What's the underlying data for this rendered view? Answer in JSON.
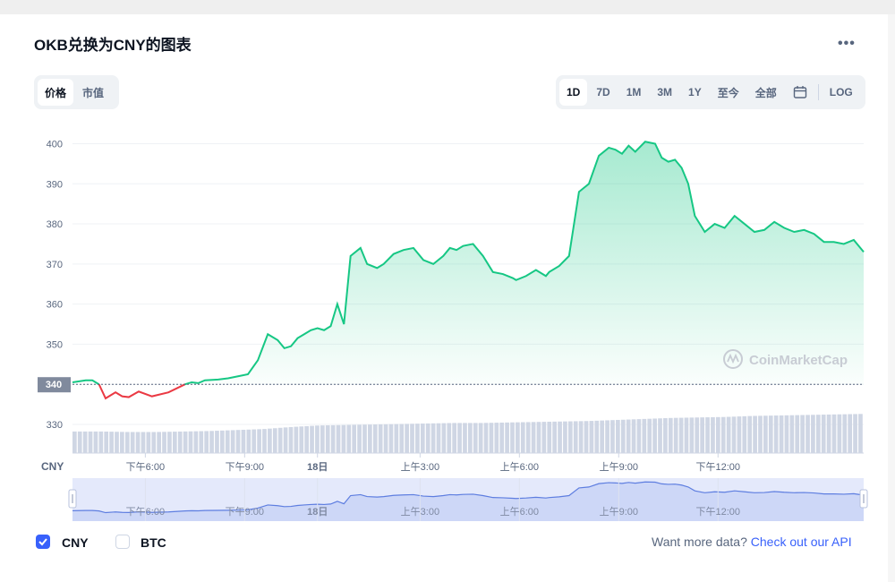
{
  "title": "OKB兑换为CNY的图表",
  "menu_icon": "more-dots-icon",
  "view_toggle": {
    "items": [
      "价格",
      "市值"
    ],
    "active": 0
  },
  "range_toggle": {
    "items": [
      "1D",
      "7D",
      "1M",
      "3M",
      "1Y",
      "至今",
      "全部"
    ],
    "active": 0,
    "calendar_icon": "calendar-icon",
    "log_label": "LOG"
  },
  "colors": {
    "up": "#16c784",
    "down": "#ea3943",
    "accent": "#3861fb",
    "volume": "#cfd6e4"
  },
  "chart_data": {
    "type": "line",
    "currency_label": "CNY",
    "watermark": "CoinMarketCap",
    "reference_price": 340,
    "reference_label": "340",
    "y_ticks": [
      400,
      390,
      380,
      370,
      360,
      350,
      340,
      330
    ],
    "ylim": [
      330,
      401
    ],
    "x_ticks": [
      "下午6:00",
      "下午9:00",
      "18日",
      "上午3:00",
      "上午6:00",
      "上午9:00",
      "下午12:00"
    ],
    "x_tick_positions": [
      3.8,
      6.8,
      9.0,
      12.1,
      15.1,
      18.1,
      21.1
    ],
    "xlim": [
      1.6,
      25.5
    ],
    "grid": true,
    "series": [
      {
        "x": [
          1.6,
          2.0,
          2.2,
          2.4,
          2.6,
          2.9,
          3.1,
          3.3,
          3.6,
          4.0,
          4.5,
          5.0,
          5.2,
          5.4,
          5.6,
          6.0,
          6.3,
          6.6,
          6.9,
          7.2,
          7.5,
          7.8,
          8.0,
          8.2,
          8.4,
          8.6,
          8.8,
          9.0,
          9.2,
          9.4,
          9.6,
          9.8,
          10.0,
          10.3,
          10.5,
          10.8,
          11.0,
          11.3,
          11.6,
          11.9,
          12.2,
          12.5,
          12.8,
          13.0,
          13.2,
          13.4,
          13.7,
          14.0,
          14.3,
          14.6,
          14.9,
          15.0,
          15.3,
          15.6,
          15.9,
          16.0,
          16.3,
          16.6,
          16.9,
          17.2,
          17.5,
          17.8,
          18.0,
          18.2,
          18.4,
          18.6,
          18.9,
          19.2,
          19.4,
          19.6,
          19.8,
          20.0,
          20.2,
          20.4,
          20.7,
          21.0,
          21.3,
          21.6,
          21.9,
          22.2,
          22.5,
          22.8,
          23.1,
          23.4,
          23.7,
          24.0,
          24.3,
          24.6,
          24.9,
          25.2,
          25.5
        ],
        "values": [
          340.5,
          341.0,
          341.0,
          340.0,
          336.5,
          338.0,
          337.0,
          336.8,
          338.2,
          337.0,
          338.0,
          340.0,
          340.5,
          340.3,
          341.0,
          341.2,
          341.5,
          342.0,
          342.5,
          346.0,
          352.5,
          351.0,
          349.0,
          349.5,
          351.5,
          352.5,
          353.5,
          354.0,
          353.5,
          354.5,
          360.0,
          355.0,
          372.0,
          374.0,
          370.0,
          369.0,
          370.0,
          372.5,
          373.5,
          374.0,
          371.0,
          370.0,
          372.0,
          374.0,
          373.5,
          374.5,
          375.0,
          372.0,
          368.0,
          367.5,
          366.5,
          366.0,
          367.0,
          368.5,
          367.0,
          368.0,
          369.5,
          372.0,
          388.0,
          390.0,
          397.0,
          399.0,
          398.5,
          397.5,
          399.5,
          398.0,
          400.5,
          400.0,
          396.5,
          395.5,
          396.0,
          394.0,
          390.0,
          382.0,
          378.0,
          380.0,
          379.0,
          382.0,
          380.0,
          378.0,
          378.5,
          380.5,
          379.0,
          378.0,
          378.5,
          377.5,
          375.5,
          375.5,
          375.0,
          376.0,
          373.0
        ]
      }
    ],
    "volume_levels": [
      0.43,
      0.43,
      0.42,
      0.42,
      0.43,
      0.44,
      0.46,
      0.48,
      0.52,
      0.55,
      0.56,
      0.57,
      0.58,
      0.59,
      0.6,
      0.6,
      0.61,
      0.62,
      0.63,
      0.64,
      0.66,
      0.68,
      0.7,
      0.71,
      0.72,
      0.74,
      0.75,
      0.76,
      0.77,
      0.78
    ],
    "navigator_ticks": [
      "下午6:00",
      "下午9:00",
      "18日",
      "上午3:00",
      "上午6:00",
      "上午9:00",
      "下午12:00"
    ]
  },
  "footer": {
    "legend": [
      {
        "label": "CNY",
        "checked": true
      },
      {
        "label": "BTC",
        "checked": false
      }
    ],
    "api_prefix": "Want more data?",
    "api_link": "Check out our API"
  }
}
